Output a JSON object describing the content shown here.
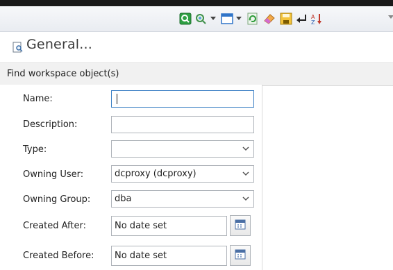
{
  "toolbar": {
    "icons": [
      "search-icon",
      "find-dropdown-icon",
      "window-icon",
      "refresh-icon",
      "clear-icon",
      "save-icon",
      "return-icon",
      "sort-icon"
    ]
  },
  "panel": {
    "title": "General...",
    "section_header": "Find workspace object(s)"
  },
  "form": {
    "name": {
      "label": "Name:",
      "value": ""
    },
    "description": {
      "label": "Description:",
      "value": ""
    },
    "type": {
      "label": "Type:",
      "value": ""
    },
    "owning_user": {
      "label": "Owning User:",
      "value": "dcproxy (dcproxy)"
    },
    "owning_group": {
      "label": "Owning Group:",
      "value": "dba"
    },
    "created_after": {
      "label": "Created After:",
      "value": "No date set"
    },
    "created_before": {
      "label": "Created Before:",
      "value": "No date set"
    }
  },
  "colors": {
    "accent": "#3b7fc4",
    "search_green": "#2ea043"
  }
}
